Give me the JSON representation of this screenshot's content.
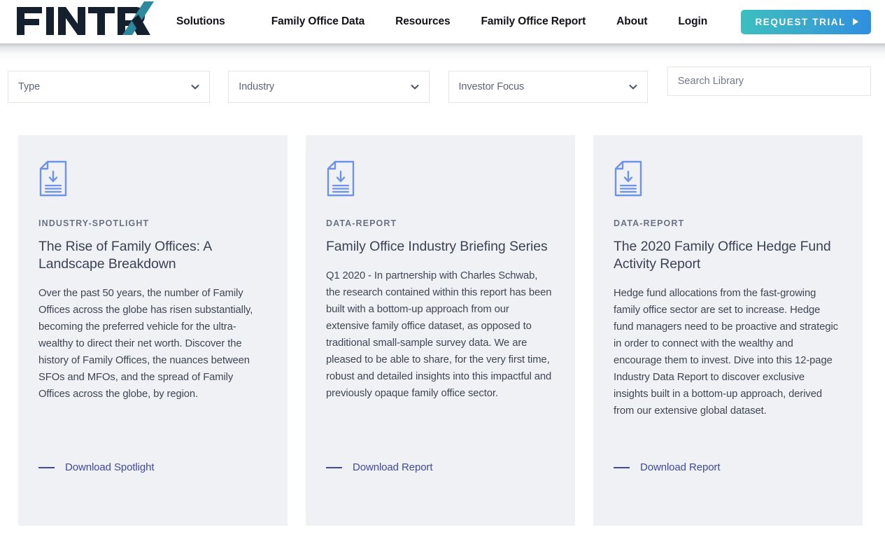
{
  "brand": {
    "name": "FINTRX",
    "logo_text_color": "#14202e",
    "logo_accent_color": "#2d8a9e"
  },
  "header": {
    "nav": [
      {
        "label": "Solutions",
        "name": "solutions"
      },
      {
        "label": "Family Office Data",
        "name": "family-office-data"
      },
      {
        "label": "Resources",
        "name": "resources"
      },
      {
        "label": "Family Office Report",
        "name": "family-office-report"
      },
      {
        "label": "About",
        "name": "about"
      },
      {
        "label": "Login",
        "name": "login"
      }
    ],
    "cta": {
      "label": "REQUEST TRIAL",
      "gradient_from": "#3cbfc0",
      "gradient_to": "#2f8fe0",
      "arrow_icon": "triangle-right-icon"
    }
  },
  "filters": {
    "type": {
      "label": "Type",
      "icon": "chevron-down-icon"
    },
    "industry": {
      "label": "Industry",
      "icon": "chevron-down-icon"
    },
    "investor_focus": {
      "label": "Investor Focus",
      "icon": "chevron-down-icon"
    },
    "search": {
      "placeholder": "Search Library",
      "value": ""
    }
  },
  "cards": [
    {
      "icon": "document-download-icon",
      "category": "INDUSTRY-SPOTLIGHT",
      "title": "The Rise of Family Offices: A Landscape Breakdown",
      "body": "Over the past 50 years, the number of Family Offices across the globe has risen substantially, becoming the preferred vehicle for the ultra-wealthy to direct their net worth. Discover the history of Family Offices, the nuances between SFOs and MFOs, and the spread of Family Offices across the globe, by region.",
      "link": "Download Spotlight"
    },
    {
      "icon": "document-download-icon",
      "category": "DATA-REPORT",
      "title": "Family Office Industry Briefing Series",
      "body": "Q1 2020 - In partnership with Charles Schwab, the research contained within this report has been built with a bottom-up approach from our extensive family office dataset, as opposed to traditional small-sample survey data. We are pleased to be able to share, for the very first time, robust and detailed insights into this impactful and previously opaque family office sector.",
      "link": "Download Report"
    },
    {
      "icon": "document-download-icon",
      "category": "DATA-REPORT",
      "title": "The 2020 Family Office Hedge Fund Activity Report",
      "body": "Hedge fund allocations from the fast-growing family office sector are set to increase.  Hedge fund managers need to be proactive and strategic in order to connect with the wealthy and encourage them to invest.  Dive into this 12-page Industry Data Report to discover exclusive insights built in a bottom-up approach, derived from our extensive global dataset.",
      "link": "Download Report"
    }
  ],
  "theme": {
    "card_background": "#f0f1f5",
    "link_color": "#3f4a9a",
    "icon_color": "#6d93e8",
    "category_color": "#6b7485",
    "title_color": "#3b4354"
  }
}
